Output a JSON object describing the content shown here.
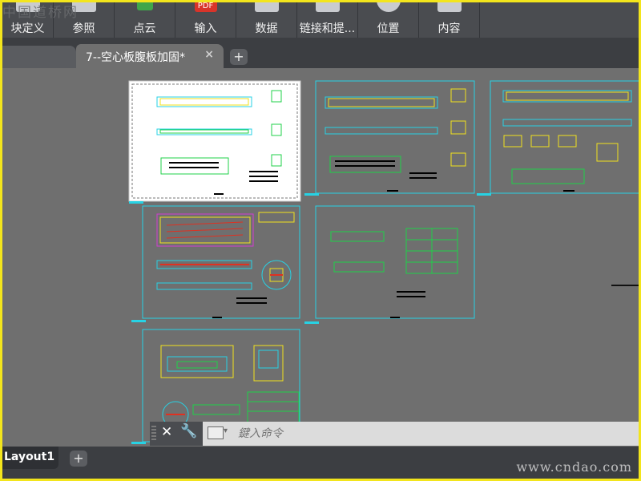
{
  "ribbon": {
    "buttons": [
      {
        "label": "块定义",
        "icon": "block-definition-icon"
      },
      {
        "label": "参照",
        "icon": "reference-icon"
      },
      {
        "label": "点云",
        "icon": "point-cloud-icon"
      },
      {
        "label": "输入",
        "icon": "pdf-import-icon"
      },
      {
        "label": "数据",
        "icon": "data-icon"
      },
      {
        "label": "链接和提...",
        "icon": "link-extract-icon"
      },
      {
        "label": "位置",
        "icon": "location-icon"
      },
      {
        "label": "内容",
        "icon": "content-icon"
      }
    ],
    "pdf_icon_text": "PDF"
  },
  "watermark_top": "中国道桥网",
  "tabs": {
    "active_file": "7--空心板腹板加固*",
    "close_glyph": "×",
    "new_tab_glyph": "+"
  },
  "command_line": {
    "placeholder": "鍵入命令",
    "close_glyph": "✕",
    "wrench_glyph": "🔧"
  },
  "layout_tabs": {
    "active": "Layout1",
    "new_glyph": "+"
  },
  "watermark_bottom": "www.cndao.com",
  "colors": {
    "frame": "#f3e51c",
    "canvas": "#6f6f6f",
    "sheet_border": "#27d2e4",
    "ribbon": "#4a4c50"
  }
}
